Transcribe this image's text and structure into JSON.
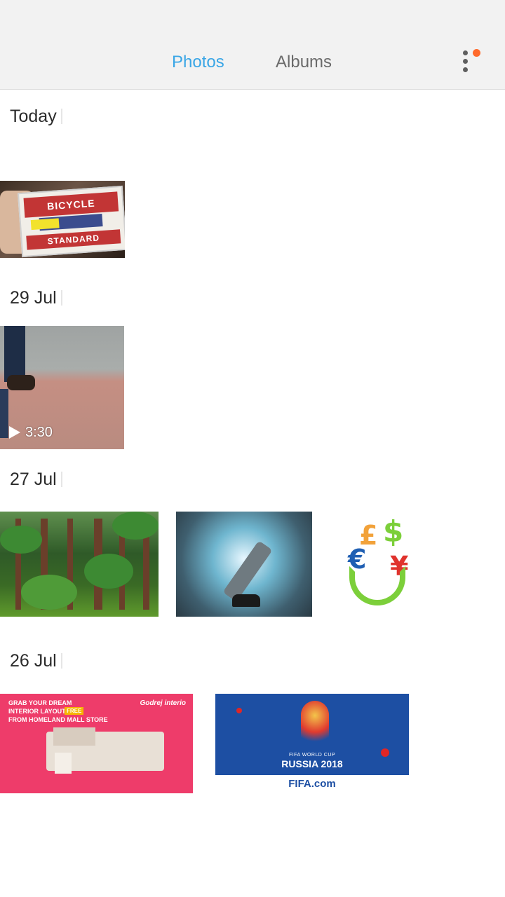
{
  "tabs": [
    {
      "label": "Photos",
      "active": true
    },
    {
      "label": "Albums",
      "active": false
    }
  ],
  "menu": {
    "icon": "more-vert-icon",
    "badge_color": "#ff6a2c"
  },
  "colors": {
    "accent": "#3aa6e6",
    "header_bg": "#f2f2f2"
  },
  "sections": [
    {
      "date": "Today"
    },
    {
      "date": "29 Jul",
      "video_duration": "3:30"
    },
    {
      "date": "27 Jul"
    },
    {
      "date": "26 Jul"
    }
  ],
  "thumbs": {
    "cards_top": "BICYCLE",
    "cards_bottom": "STANDARD",
    "ad_line1": "GRAB YOUR DREAM",
    "ad_line2": "INTERIOR LAYOUT",
    "ad_free": "FREE",
    "ad_line3": "FROM HOMELAND MALL STORE",
    "ad_logo": "Godrej interio",
    "fifa_caption_small": "FIFA WORLD CUP",
    "fifa_caption_big": "RUSSIA 2018",
    "fifa_site": "FIFA.com"
  }
}
